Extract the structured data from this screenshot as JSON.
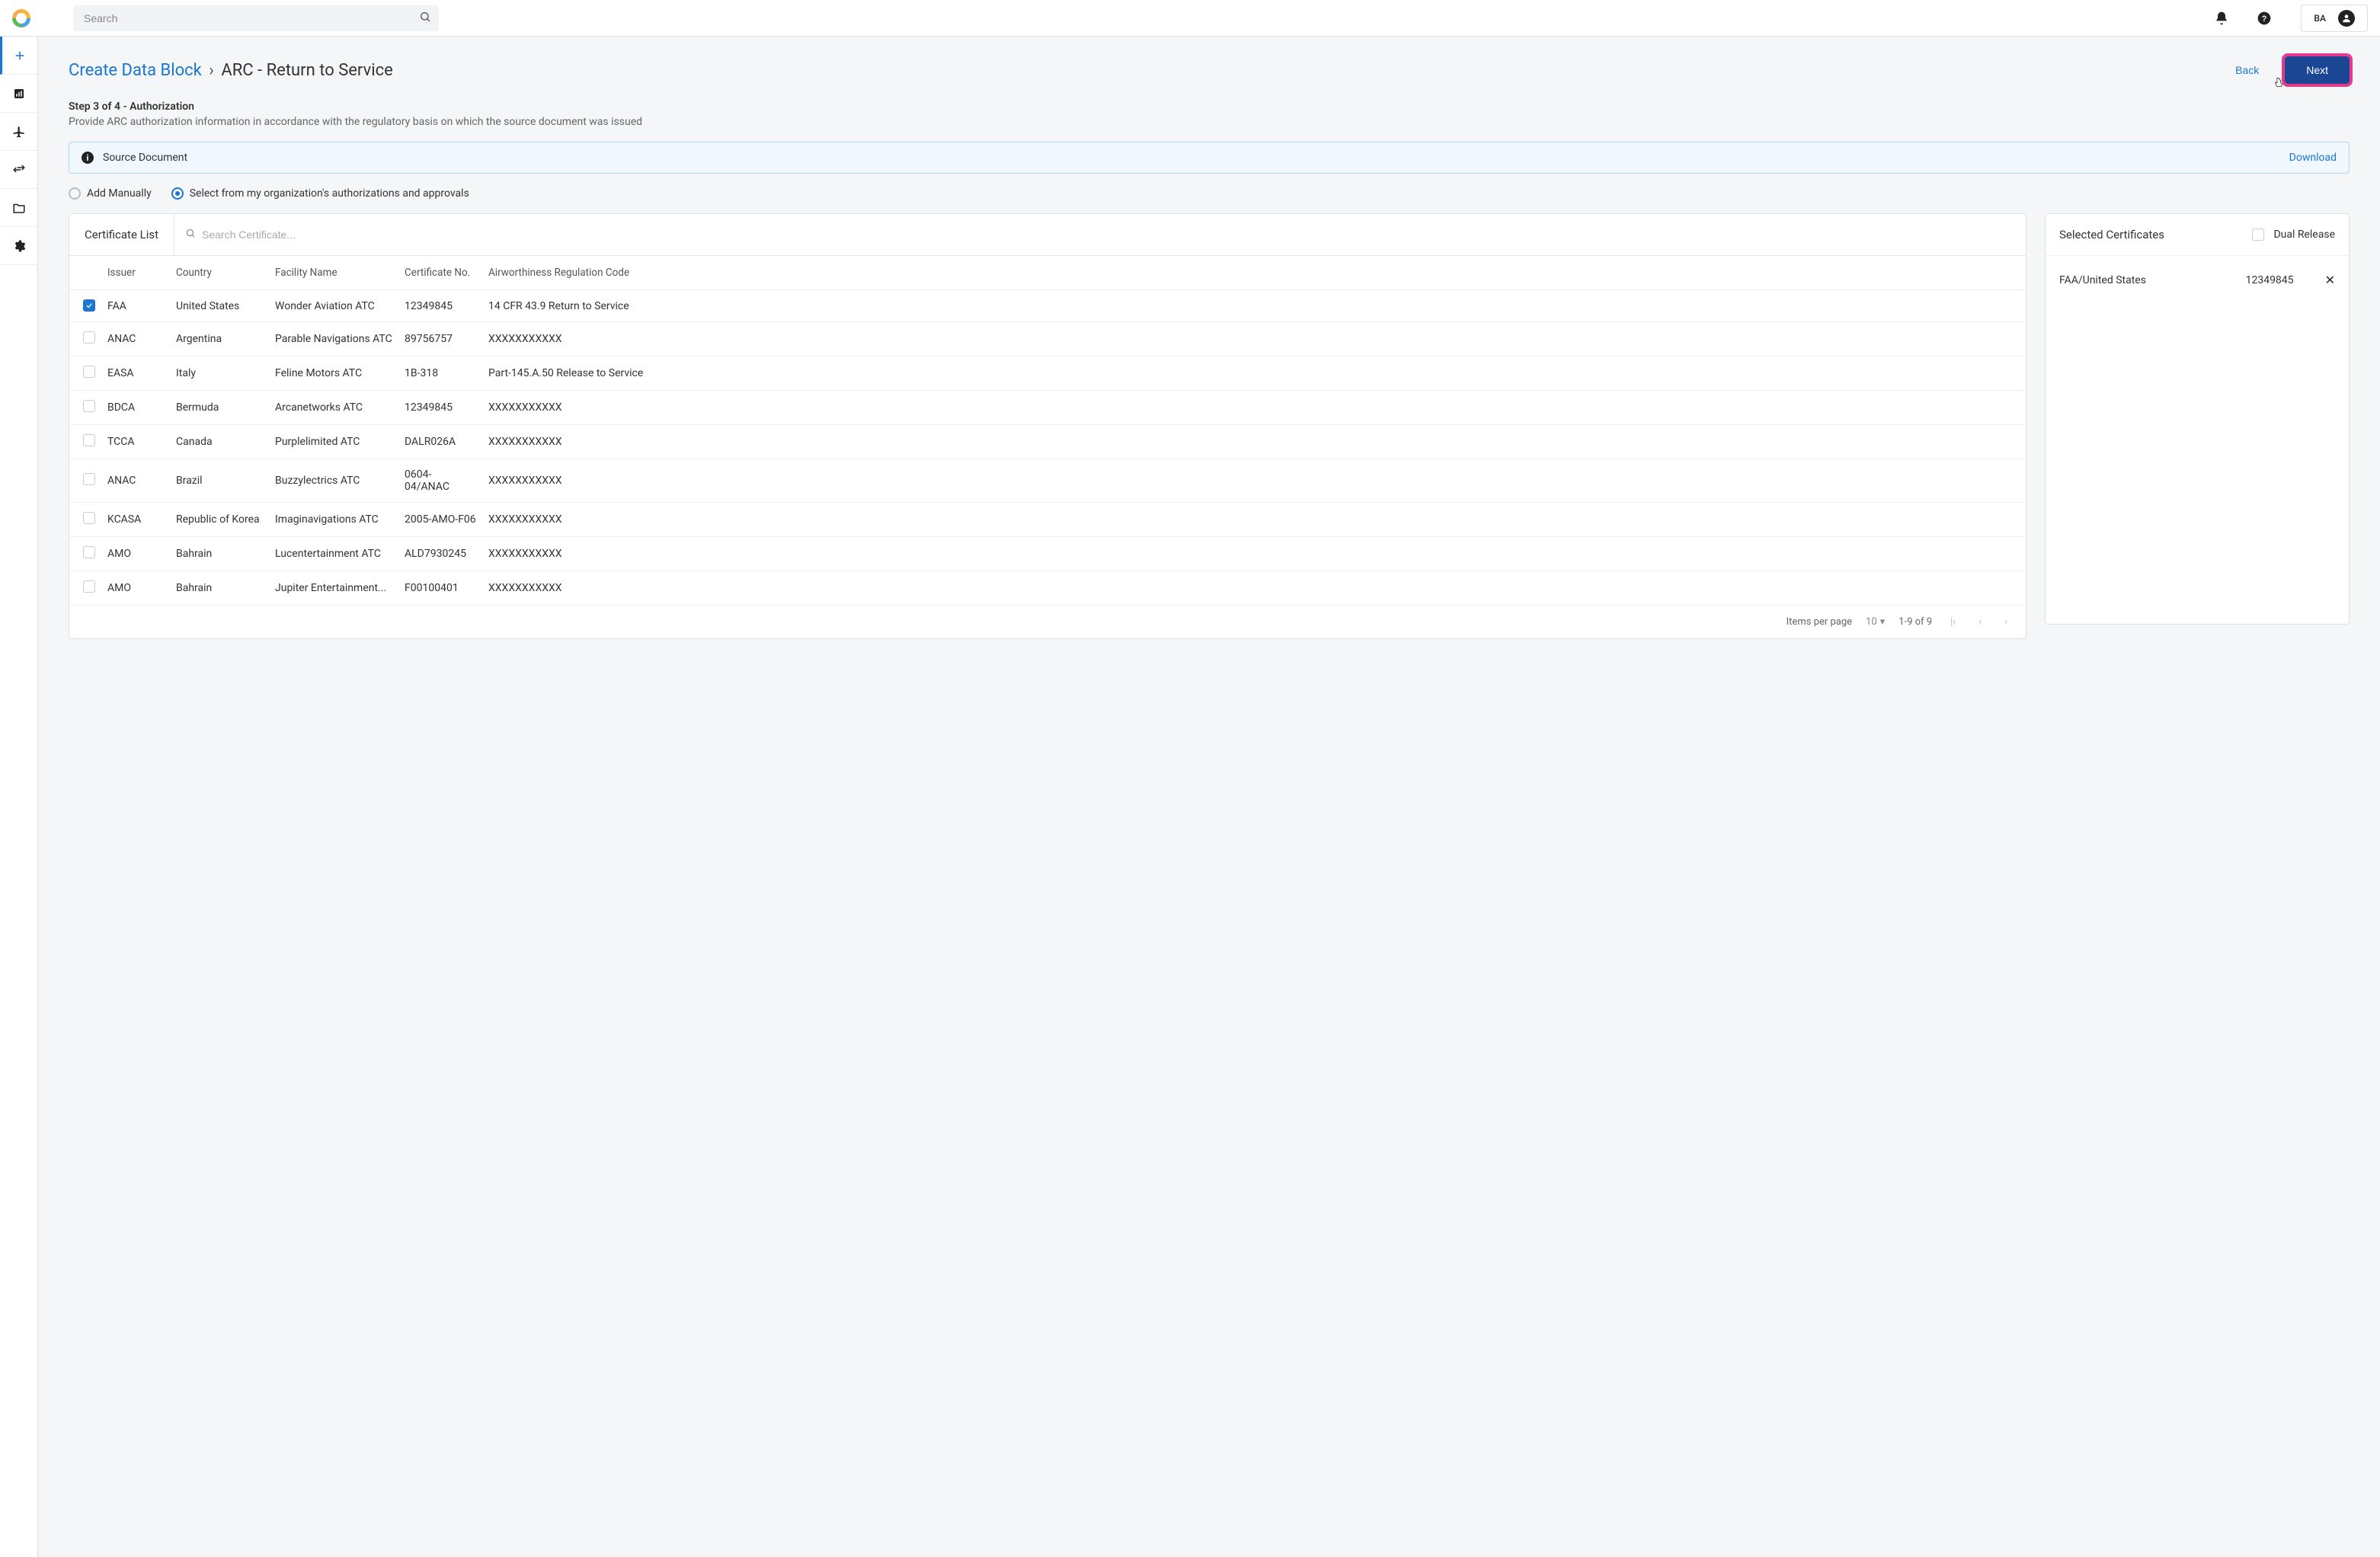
{
  "topbar": {
    "search_placeholder": "Search",
    "user_initials": "BA"
  },
  "breadcrumb": {
    "link_label": "Create Data Block",
    "separator": "›",
    "current": "ARC - Return to Service"
  },
  "actions": {
    "back_label": "Back",
    "next_label": "Next"
  },
  "step": {
    "title": "Step 3 of 4 - Authorization",
    "description": "Provide ARC authorization information in accordance with the regulatory basis on which the source document was issued"
  },
  "banner": {
    "label": "Source Document",
    "download_label": "Download"
  },
  "radios": {
    "add_manually": "Add Manually",
    "select_from_org": "Select from my organization's authorizations and approvals",
    "selected": "select_from_org"
  },
  "cert_panel": {
    "title": "Certificate List",
    "search_placeholder": "Search Certificate...",
    "columns": {
      "issuer": "Issuer",
      "country": "Country",
      "facility": "Facility Name",
      "cert_no": "Certificate No.",
      "arc": "Airworthiness Regulation Code"
    },
    "rows": [
      {
        "checked": true,
        "issuer": "FAA",
        "country": "United States",
        "facility": "Wonder Aviation ATC",
        "cert_no": "12349845",
        "arc": "14 CFR 43.9 Return to Service"
      },
      {
        "checked": false,
        "issuer": "ANAC",
        "country": "Argentina",
        "facility": "Parable Navigations ATC",
        "cert_no": "89756757",
        "arc": "XXXXXXXXXXX"
      },
      {
        "checked": false,
        "issuer": "EASA",
        "country": "Italy",
        "facility": "Feline Motors ATC",
        "cert_no": "1B-318",
        "arc": "Part-145.A.50 Release to Service"
      },
      {
        "checked": false,
        "issuer": "BDCA",
        "country": "Bermuda",
        "facility": "Arcanetworks ATC",
        "cert_no": "12349845",
        "arc": "XXXXXXXXXXX"
      },
      {
        "checked": false,
        "issuer": "TCCA",
        "country": "Canada",
        "facility": "Purplelimited ATC",
        "cert_no": "DALR026A",
        "arc": "XXXXXXXXXXX"
      },
      {
        "checked": false,
        "issuer": "ANAC",
        "country": "Brazil",
        "facility": "Buzzylectrics ATC",
        "cert_no": "0604-04/ANAC",
        "arc": "XXXXXXXXXXX"
      },
      {
        "checked": false,
        "issuer": "KCASA",
        "country": "Republic of Korea",
        "facility": "Imaginavigations ATC",
        "cert_no": "2005-AMO-F06",
        "arc": "XXXXXXXXXXX"
      },
      {
        "checked": false,
        "issuer": "AMO",
        "country": "Bahrain",
        "facility": "Lucentertainment ATC",
        "cert_no": "ALD7930245",
        "arc": "XXXXXXXXXXX"
      },
      {
        "checked": false,
        "issuer": "AMO",
        "country": "Bahrain",
        "facility": "Jupiter Entertainment...",
        "cert_no": "F00100401",
        "arc": "XXXXXXXXXXX"
      }
    ],
    "pager": {
      "items_per_page_label": "Items per page",
      "items_per_page_value": "10",
      "range_text": "1-9 of 9"
    }
  },
  "selected_panel": {
    "title": "Selected Certificates",
    "dual_release_label": "Dual Release",
    "dual_release_checked": false,
    "items": [
      {
        "name": "FAA/United States",
        "cert_no": "12349845"
      }
    ]
  }
}
